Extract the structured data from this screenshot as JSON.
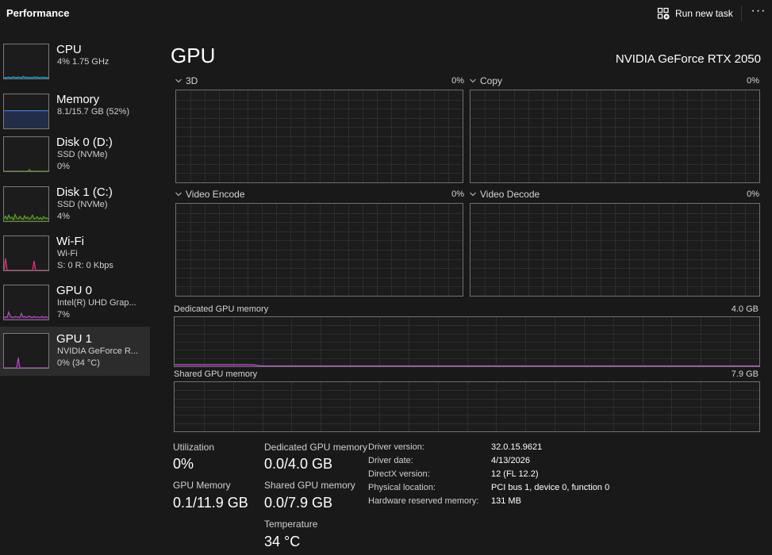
{
  "header": {
    "title": "Performance",
    "run_new_task": "Run new task"
  },
  "sidebar": {
    "items": [
      {
        "name": "CPU",
        "line1": "4%  1.75 GHz",
        "line2": "",
        "color": "#17a9e6",
        "icon": "cpu-graph",
        "samples": [
          3,
          2,
          3,
          4,
          2,
          3,
          5,
          3,
          2,
          4,
          3,
          2,
          6,
          3,
          4,
          2,
          3,
          3,
          2,
          5,
          3,
          4,
          2,
          3,
          3,
          4,
          2,
          3,
          2
        ]
      },
      {
        "name": "Memory",
        "line1": "8.1/15.7 GB (52%)",
        "line2": "",
        "color": "#3c74e8",
        "icon": "memory-graph",
        "samples": [
          52,
          52,
          52,
          52,
          52,
          52,
          52,
          52,
          52,
          52,
          52,
          52,
          52,
          52,
          52,
          52,
          52,
          52,
          52,
          52,
          52,
          52,
          52,
          52,
          52,
          52,
          52,
          52,
          52
        ]
      },
      {
        "name": "Disk 0 (D:)",
        "line1": "SSD (NVMe)",
        "line2": "0%",
        "color": "#5aa11a",
        "icon": "disk-graph",
        "samples": [
          0,
          0,
          0,
          0,
          0,
          0,
          0,
          0,
          0,
          0,
          0,
          0,
          0,
          0,
          0,
          0,
          5,
          0,
          0,
          0,
          0,
          0,
          0,
          0,
          0,
          0,
          0,
          0,
          0
        ]
      },
      {
        "name": "Disk 1 (C:)",
        "line1": "SSD (NVMe)",
        "line2": "4%",
        "color": "#5aa11a",
        "icon": "disk-graph",
        "samples": [
          8,
          15,
          6,
          18,
          9,
          12,
          4,
          20,
          10,
          7,
          14,
          9,
          5,
          16,
          8,
          12,
          6,
          10,
          18,
          7,
          9,
          13,
          6,
          11,
          5,
          14,
          8,
          10,
          7
        ]
      },
      {
        "name": "Wi-Fi",
        "line1": "Wi-Fi",
        "line2": "S: 0  R: 0 Kbps",
        "color": "#d8347a",
        "icon": "wifi-graph",
        "samples": [
          0,
          35,
          0,
          0,
          0,
          0,
          0,
          0,
          0,
          0,
          0,
          0,
          0,
          0,
          0,
          0,
          0,
          0,
          0,
          28,
          0,
          0,
          0,
          0,
          0,
          0,
          0,
          0,
          0
        ]
      },
      {
        "name": "GPU 0",
        "line1": "Intel(R) UHD Grap...",
        "line2": "7%",
        "color": "#b446c8",
        "icon": "gpu-graph",
        "samples": [
          5,
          8,
          6,
          22,
          10,
          7,
          6,
          9,
          8,
          7,
          6,
          18,
          7,
          9,
          6,
          8,
          10,
          7,
          6,
          9,
          7,
          8,
          6,
          7,
          9,
          6,
          8,
          7,
          6
        ]
      },
      {
        "name": "GPU 1",
        "line1": "NVIDIA GeForce R...",
        "line2": "0%  (34 °C)",
        "color": "#b446c8",
        "icon": "gpu-graph",
        "samples": [
          0,
          0,
          0,
          0,
          0,
          0,
          0,
          0,
          0,
          30,
          0,
          0,
          0,
          0,
          0,
          0,
          0,
          0,
          0,
          0,
          0,
          0,
          0,
          0,
          0,
          0,
          0,
          0,
          0
        ]
      }
    ]
  },
  "main": {
    "title": "GPU",
    "model": "NVIDIA GeForce RTX 2050",
    "engines": [
      {
        "label": "3D",
        "percent": "0%"
      },
      {
        "label": "Copy",
        "percent": "0%"
      },
      {
        "label": "Video Encode",
        "percent": "0%"
      },
      {
        "label": "Video Decode",
        "percent": "0%"
      }
    ],
    "dedicated_memory": {
      "label": "Dedicated GPU memory",
      "max": "4.0 GB",
      "samples": [
        0.12,
        0.12,
        0.12,
        0.12,
        0.12,
        0.12,
        0.12,
        0.08,
        0.03,
        0,
        0,
        0,
        0,
        0,
        0,
        0,
        0,
        0,
        0,
        0,
        0,
        0,
        0,
        0,
        0,
        0,
        0,
        0,
        0,
        0,
        0,
        0,
        0,
        0,
        0,
        0,
        0,
        0,
        0,
        0,
        0,
        0,
        0,
        0,
        0,
        0,
        0,
        0,
        0,
        0,
        0,
        0,
        0,
        0,
        0,
        0,
        0,
        0,
        0,
        0,
        0
      ]
    },
    "shared_memory": {
      "label": "Shared GPU memory",
      "max": "7.9 GB"
    },
    "stats": {
      "utilization_label": "Utilization",
      "utilization_value": "0%",
      "gpu_memory_label": "GPU Memory",
      "gpu_memory_value": "0.1/11.9 GB",
      "dedicated_label": "Dedicated GPU memory",
      "dedicated_value": "0.0/4.0 GB",
      "shared_label": "Shared GPU memory",
      "shared_value": "0.0/7.9 GB",
      "temperature_label": "Temperature",
      "temperature_value": "34 °C"
    },
    "info": [
      {
        "key": "Driver version:",
        "value": "32.0.15.9621"
      },
      {
        "key": "Driver date:",
        "value": "4/13/2026"
      },
      {
        "key": "DirectX version:",
        "value": "12 (FL 12.2)"
      },
      {
        "key": "Physical location:",
        "value": "PCI bus 1, device 0, function 0"
      },
      {
        "key": "Hardware reserved memory:",
        "value": "131 MB"
      }
    ]
  }
}
